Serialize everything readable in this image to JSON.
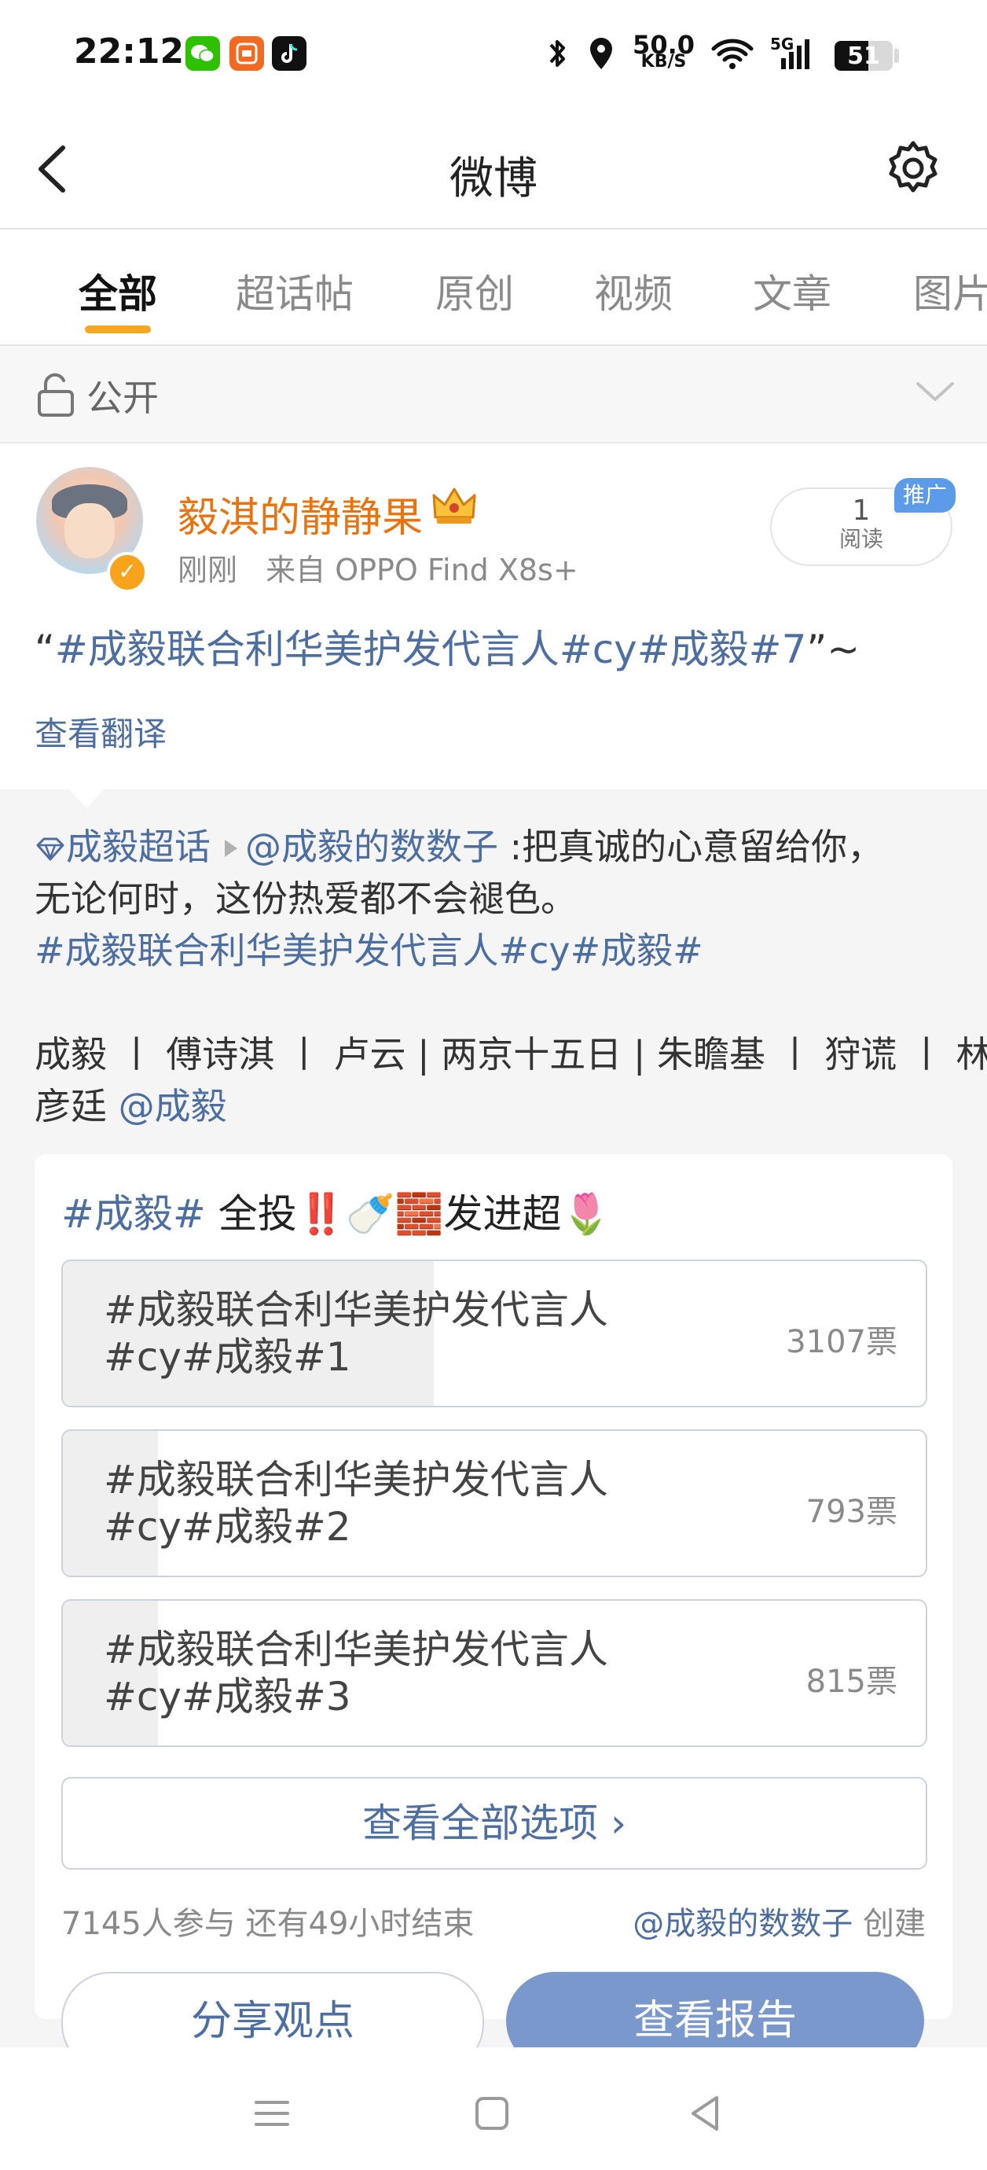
{
  "status_bar": {
    "time": "22:12",
    "speed_value": "50.0",
    "speed_unit": "KB/S",
    "network": "5G",
    "battery": "51",
    "apps": [
      {
        "icon": "wechat-icon",
        "color": "#2dc100"
      },
      {
        "icon": "xiaohongshu-icon",
        "color": "#f26a21"
      },
      {
        "icon": "tiktok-icon",
        "color": "#111111"
      }
    ]
  },
  "header": {
    "title": "微博"
  },
  "tabs": [
    "全部",
    "超话帖",
    "原创",
    "视频",
    "文章",
    "图片"
  ],
  "privacy": {
    "label": "公开"
  },
  "post": {
    "username": "毅淇的静静果",
    "time": "刚刚",
    "source": "来自 OPPO Find X8s+",
    "read_count": "1",
    "read_label": "阅读",
    "promo_label": "推广",
    "text_open": "“",
    "text_link": "#成毅联合利华美护发代言人#cy#成毅#7",
    "text_close": "”~",
    "translate_label": "查看翻译"
  },
  "repost": {
    "topic": "成毅超话",
    "author": "@成毅的数数子",
    "text_1": " :把真诚的心意留给你，",
    "text_2": "无论何时，这份热爱都不会褪色。",
    "hashtag": "#成毅联合利华美护发代言人#cy#成毅#",
    "roles_1": "成毅 丨 傅诗淇 丨 卢云 | 两京十五日 | 朱瞻基 丨 狩谎 丨 林",
    "roles_2_text": "彦廷 ",
    "roles_2_mention": "@成毅"
  },
  "poll": {
    "title_tag": "#成毅#",
    "title_text": " 全投",
    "title_emojis": "‼️🍼🧱",
    "title_end": "发进超🌷",
    "options": [
      {
        "line1": "#成毅联合利华美护发代言人",
        "line2": "#cy#成毅#1",
        "votes": "3107票",
        "share": 0.43
      },
      {
        "line1": "#成毅联合利华美护发代言人",
        "line2": "#cy#成毅#2",
        "votes": "793票",
        "share": 0.11
      },
      {
        "line1": "#成毅联合利华美护发代言人",
        "line2": "#cy#成毅#3",
        "votes": "815票",
        "share": 0.11
      }
    ],
    "view_all": "查看全部选项 ›",
    "participants": "7145人参与  还有49小时结束",
    "creator": "@成毅的数数子",
    "creator_suffix": " 创建",
    "share_button": "分享观点",
    "report_button": "查看报告"
  },
  "colors": {
    "accent_orange": "#f5a623",
    "link_blue": "#4d6ea0",
    "username_orange": "#e8730f",
    "report_button": "#7b98cc"
  }
}
